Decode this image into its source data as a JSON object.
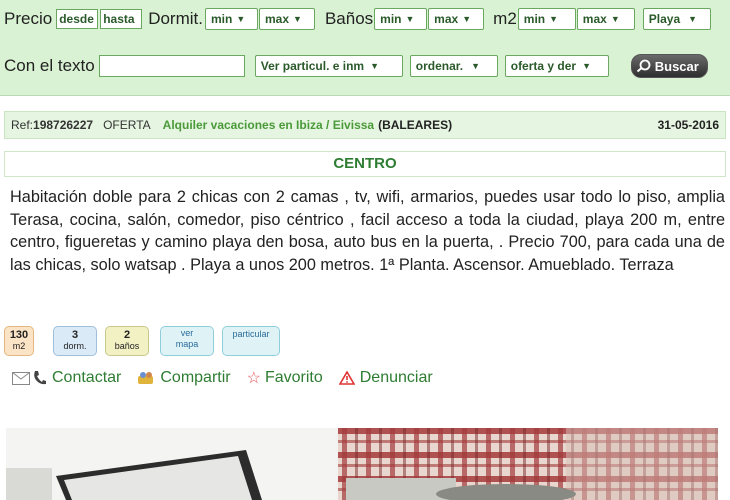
{
  "search": {
    "precio_label": "Precio",
    "desde": "desde",
    "hasta": "hasta",
    "dormit_label": "Dormit.",
    "dormit_min": "min",
    "dormit_max": "max",
    "banos_label": "Baños",
    "banos_min": "min",
    "banos_max": "max",
    "m2_label": "m2",
    "m2_min": "min",
    "m2_max": "max",
    "playa": "Playa",
    "texto_label": "Con el texto",
    "texto_value": "",
    "particul": "Ver particul. e inm",
    "ordenar": "ordenar.",
    "oferta": "oferta y der",
    "buscar": "Buscar"
  },
  "listing": {
    "ref_prefix": "Ref:",
    "ref_number": "198726227",
    "type": "OFERTA",
    "category_link": "Alquiler vacaciones en Ibiza / Eivissa",
    "region": "(BALEARES)",
    "date": "31-05-2016",
    "zone": "CENTRO",
    "description": "Habitación doble para 2 chicas con 2 camas , tv, wifi, armarios, puedes usar todo lo piso, amplia Terasa, cocina, salón, comedor, piso céntrico , facil acceso a toda la ciudad, playa 200 m, entre centro, figueretas y camino playa den bosa, auto bus en la puerta, . Precio 700, para cada una de las chicas, solo watsap . Playa a unos 200 metros. 1ª Planta. Ascensor. Amueblado. Terraza"
  },
  "badges": {
    "m2_value": "130",
    "m2_unit": "m2",
    "dorm_value": "3",
    "dorm_unit": "dorm.",
    "banos_value": "2",
    "banos_unit": "baños",
    "mapa_line1": "ver",
    "mapa_line2": "mapa",
    "particular": "particular"
  },
  "actions": {
    "contactar": "Contactar",
    "compartir": "Compartir",
    "favorito": "Favorito",
    "denunciar": "Denunciar"
  },
  "colors": {
    "searchbar_bg": "#d9f2d3",
    "link_green": "#2e7d32",
    "badge_orange": "#fbe3c5",
    "badge_blue": "#dbeaf7",
    "badge_yellow": "#f2f1c4",
    "badge_cyan": "#dff3f7"
  }
}
